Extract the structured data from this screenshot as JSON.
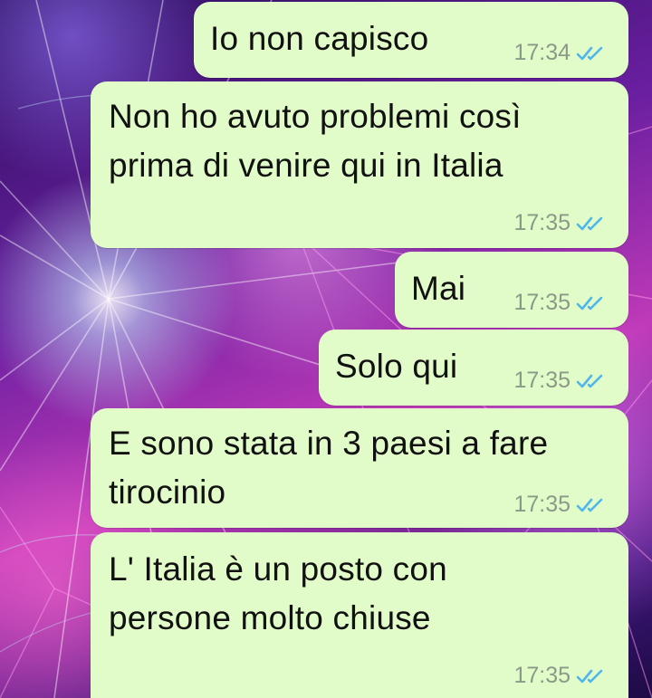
{
  "chat": {
    "messages": [
      {
        "text": "Io non capisco",
        "time": "17:34",
        "status": "read-double-check-icon"
      },
      {
        "text": "Non ho avuto problemi così\nprima di venire qui in Italia",
        "time": "17:35",
        "status": "read-double-check-icon"
      },
      {
        "text": "Mai",
        "time": "17:35",
        "status": "read-double-check-icon"
      },
      {
        "text": "Solo qui",
        "time": "17:35",
        "status": "read-double-check-icon"
      },
      {
        "text": "E sono stata in 3 paesi a fare\ntirocinio",
        "time": "17:35",
        "status": "read-double-check-icon"
      },
      {
        "text": "L' Italia è un posto con\npersone molto chiuse",
        "time": "17:35",
        "status": "read-double-check-icon"
      }
    ]
  },
  "colors": {
    "bubble": "#e1fcc8",
    "tick": "#4fb6ec",
    "meta": "#8b9a88"
  }
}
